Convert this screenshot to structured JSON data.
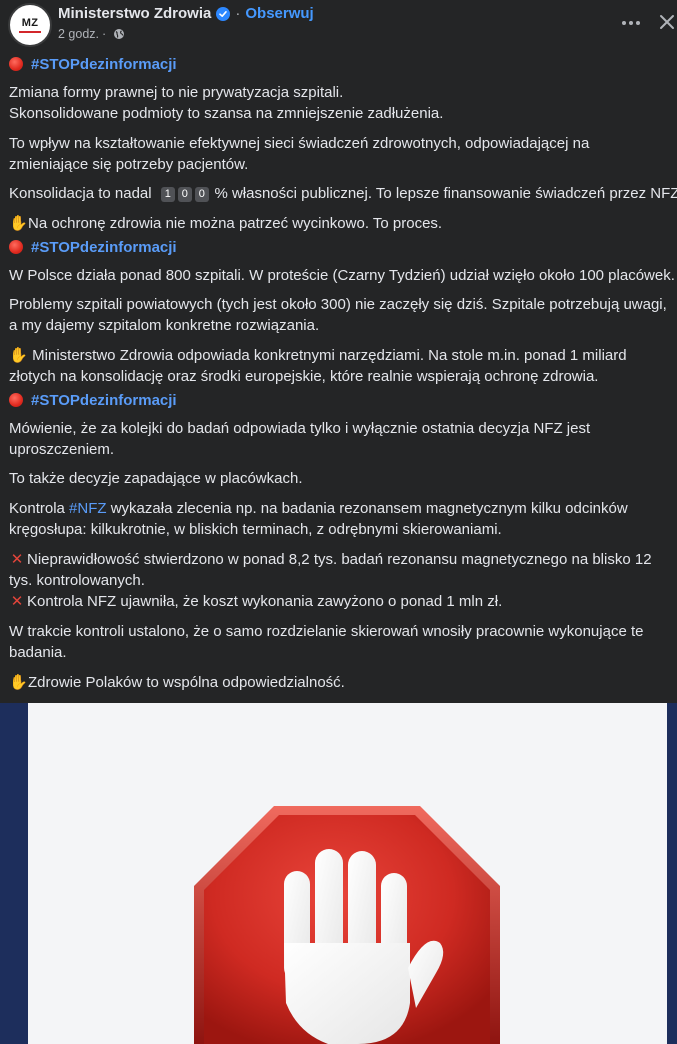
{
  "header": {
    "page_name": "Ministerstwo Zdrowia",
    "follow_label": "Obserwuj",
    "time": "2 godz.",
    "avatar_text": "MZ"
  },
  "post": {
    "hashtag_stop": "#STOPdezinformacji",
    "hashtag_nfz": "#NFZ",
    "l1": "Zmiana formy prawnej to nie prywatyzacja szpitali.",
    "l2": "Skonsolidowane podmioty to szansa na zmniejszenie zadłużenia.",
    "l3": "To wpływ na kształtowanie efektywnej sieci świadczeń zdrowotnych, odpowiadającej na",
    "l4": "zmieniające się potrzeby pacjentów.",
    "l5a": "Konsolidacja to nadal",
    "digits": [
      "1",
      "0",
      "0"
    ],
    "l5b": "% własności publicznej. To lepsze finansowanie świadczeń przez NFZ.",
    "l6": "Na ochronę zdrowia nie można patrzeć wycinkowo. To proces.",
    "l7": "W Polsce działa ponad 800 szpitali. W proteście (Czarny Tydzień) udział wzięło około 100 placówek.",
    "l8": "Problemy szpitali powiatowych (tych jest około 300)  nie zaczęły się dziś. Szpitale potrzebują uwagi,",
    "l9": "a my dajemy szpitalom konkretne rozwiązania.",
    "l10": "Ministerstwo Zdrowia odpowiada konkretnymi narzędziami. Na stole m.in. ponad 1 miliard",
    "l11": "złotych na konsolidację oraz środki europejskie, które realnie wspierają ochronę zdrowia.",
    "l12": "Mówienie, że za kolejki do badań odpowiada tylko i wyłącznie ostatnia decyzja NFZ jest",
    "l13": "uproszczeniem.",
    "l14": "To także decyzje zapadające w placówkach.",
    "l15a": "Kontrola",
    "l15b": "wykazała zlecenia np. na badania rezonansem magnetycznym kilku odcinków",
    "l16": "kręgosłupa: kilkukrotnie, w bliskich terminach, z odrębnymi skierowaniami.",
    "l17": "Nieprawidłowość stwierdzono w ponad 8,2 tys. badań rezonansu magnetycznego na blisko 12",
    "l18": "tys. kontrolowanych.",
    "l19": "Kontrola NFZ ujawniła, że koszt wykonania zawyżono o ponad 1 mln zł.",
    "l20": "W trakcie kontroli ustalono, że o samo rozdzielanie skierowań wnosiły pracownie wykonujące te",
    "l21": "badania.",
    "l22": "Zdrowie Polaków to wspólna odpowiedzialność."
  },
  "icons": {
    "verified": "verified-badge-icon",
    "globe": "globe-icon",
    "more": "more-options-icon",
    "close": "close-icon",
    "stop": "red-circle-icon",
    "hand": "raised-hand-icon",
    "cross": "cross-mark-icon",
    "image": "stop-sign-hand-image"
  },
  "colors": {
    "background": "#242526",
    "text": "#e4e6eb",
    "link": "#5a9cf8",
    "follow": "#4599ff",
    "stop_red": "#d8322a",
    "image_side": "#1d2e5c"
  }
}
